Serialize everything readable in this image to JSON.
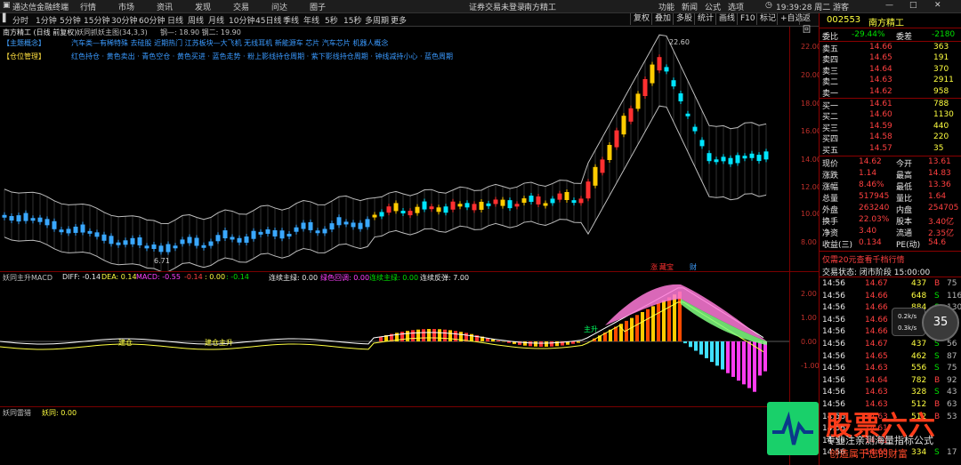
{
  "app": {
    "title": "通达信金融终端",
    "menu": [
      "行情",
      "市场",
      "资讯",
      "发现",
      "交易",
      "问达",
      "圈子"
    ],
    "login_notice": "证券交易未登录",
    "stock_label": "南方精工",
    "right_menu": [
      "功能",
      "新闻",
      "公式",
      "选项"
    ],
    "clock": "19:39:28 周二",
    "guest": "游客"
  },
  "periods": {
    "items": [
      "分时",
      "1分钟",
      "5分钟",
      "15分钟",
      "30分钟",
      "60分钟",
      "日线",
      "周线",
      "月线",
      "10分钟",
      "45日线",
      "季线",
      "年线",
      "5秒",
      "15秒",
      "多周期",
      "更多"
    ],
    "active": "日线",
    "buttons": [
      "复权",
      "叠加",
      "多股",
      "统计",
      "画线",
      "F10",
      "标记",
      "+自选",
      "返回"
    ]
  },
  "main_chart": {
    "title": "南方精工 (日线 前复权)",
    "indicator": "妖同抓妖主图(34,3,3)",
    "values_text": "钢—: 18.90  钢二: 19.90",
    "tag1_label": "【主题概念】",
    "tag1_text": "汽车类—有稀特殊 去硅股 近期热门 江苏板块—大飞机 无线耳机 新能源车 芯片 汽车芯片 机器人概念",
    "tag2_label": "【仓位管理】",
    "tag2_text": "红色持仓 · 黄色卖出 · 青色空仓 · 黄色买进 · 蓝色走势 · 粉上影线持仓周期 · 紫下影线持仓周期 · 钟线减持小心 · 蓝色周期",
    "high_label": "22.60",
    "low_label": "6.71",
    "axis": [
      "22.00",
      "20.00",
      "18.00",
      "16.00",
      "14.00",
      "12.00",
      "10.00",
      "8.00"
    ],
    "event_tags": [
      "涨",
      "藏宝",
      "财"
    ]
  },
  "macd": {
    "title": "妖同主升MACD",
    "diff": "DIFF: -0.14",
    "dea": "DEA: 0.14",
    "macd": "MACD: -0.55",
    "v1": "-0.14",
    "v2": ": 0.00",
    "v3": ": -0.14",
    "v4": "连续主绿: 0.00",
    "v5": "绿色回调: 0.00",
    "v6": "连续主绿: 0.00",
    "v7": "连续反弹: 7.00",
    "axis": [
      "2.00",
      "1.00",
      "0.00",
      "-1.00"
    ],
    "marker1": "建仓",
    "marker2": "建仓主升",
    "marker3": "主升"
  },
  "bottom": {
    "title": "妖同雷猎",
    "value": "妖同: 0.00"
  },
  "quote": {
    "code": "002553",
    "name": "南方精工",
    "weibi_label": "委比",
    "weibi": "-29.44%",
    "weicha_label": "委差",
    "weicha": "-2180",
    "asks": [
      {
        "label": "卖五",
        "price": "14.66",
        "vol": "363"
      },
      {
        "label": "卖四",
        "price": "14.65",
        "vol": "191"
      },
      {
        "label": "卖三",
        "price": "14.64",
        "vol": "370"
      },
      {
        "label": "卖二",
        "price": "14.63",
        "vol": "2911"
      },
      {
        "label": "卖一",
        "price": "14.62",
        "vol": "958"
      }
    ],
    "bids": [
      {
        "label": "买一",
        "price": "14.61",
        "vol": "788"
      },
      {
        "label": "买二",
        "price": "14.60",
        "vol": "1130"
      },
      {
        "label": "买三",
        "price": "14.59",
        "vol": "440"
      },
      {
        "label": "买四",
        "price": "14.58",
        "vol": "220"
      },
      {
        "label": "买五",
        "price": "14.57",
        "vol": "35"
      }
    ],
    "stats": [
      {
        "l1": "现价",
        "v1": "14.62",
        "l2": "今开",
        "v2": "13.61"
      },
      {
        "l1": "涨跌",
        "v1": "1.14",
        "l2": "最高",
        "v2": "14.83"
      },
      {
        "l1": "涨幅",
        "v1": "8.46%",
        "l2": "最低",
        "v2": "13.36"
      },
      {
        "l1": "总量",
        "v1": "517945",
        "l2": "量比",
        "v2": "1.64"
      },
      {
        "l1": "外盘",
        "v1": "263240",
        "l2": "内盘",
        "v2": "254705"
      },
      {
        "l1": "换手",
        "v1": "22.03%",
        "l2": "股本",
        "v2": "3.40亿"
      },
      {
        "l1": "净资",
        "v1": "3.40",
        "l2": "流通",
        "v2": "2.35亿"
      },
      {
        "l1": "收益(三)",
        "v1": "0.134",
        "l2": "PE(动)",
        "v2": "54.6"
      }
    ],
    "promo": "仅需20元查看千档行情",
    "trade_state": "交易状态: 闭市阶段 15:00:00",
    "ticks": [
      {
        "t": "14:56",
        "p": "14.67",
        "v": "437",
        "bs": "B",
        "n": "75"
      },
      {
        "t": "14:56",
        "p": "14.66",
        "v": "648",
        "bs": "S",
        "n": "116"
      },
      {
        "t": "14:56",
        "p": "14.66",
        "v": "884",
        "bs": "S",
        "n": "130"
      },
      {
        "t": "14:56",
        "p": "14.66",
        "v": "",
        "bs": "",
        "n": ""
      },
      {
        "t": "14:56",
        "p": "14.66",
        "v": "",
        "bs": "",
        "n": ""
      },
      {
        "t": "14:56",
        "p": "14.67",
        "v": "437",
        "bs": "S",
        "n": "56"
      },
      {
        "t": "14:56",
        "p": "14.65",
        "v": "462",
        "bs": "S",
        "n": "87"
      },
      {
        "t": "14:56",
        "p": "14.63",
        "v": "556",
        "bs": "S",
        "n": "75"
      },
      {
        "t": "14:56",
        "p": "14.64",
        "v": "782",
        "bs": "B",
        "n": "92"
      },
      {
        "t": "14:56",
        "p": "14.63",
        "v": "328",
        "bs": "S",
        "n": "43"
      },
      {
        "t": "14:56",
        "p": "14.63",
        "v": "512",
        "bs": "B",
        "n": "63"
      },
      {
        "t": "14:56",
        "p": "14.63",
        "v": "512",
        "bs": "B",
        "n": "53"
      },
      {
        "t": "14:56",
        "p": "14.61",
        "v": "",
        "bs": "",
        "n": ""
      },
      {
        "t": "14:56",
        "p": "14.61",
        "v": "",
        "bs": "",
        "n": ""
      },
      {
        "t": "14:56",
        "p": "14.63",
        "v": "334",
        "bs": "S",
        "n": "17"
      }
    ],
    "gauge": "35",
    "speed_up": "0.2k/s",
    "speed_down": "0.3k/s"
  },
  "brand": {
    "name": "股票六六",
    "tag1": "专业注亲测海量指标公式",
    "tag2": "创造属于您的财富"
  },
  "colors": {
    "up": "#ff4040",
    "down": "#00e000",
    "kline_yellow": "#ffcc00",
    "kline_cyan": "#00e5ff",
    "macd_magenta": "#ff3cf0",
    "macd_cyan": "#40e0ff"
  }
}
